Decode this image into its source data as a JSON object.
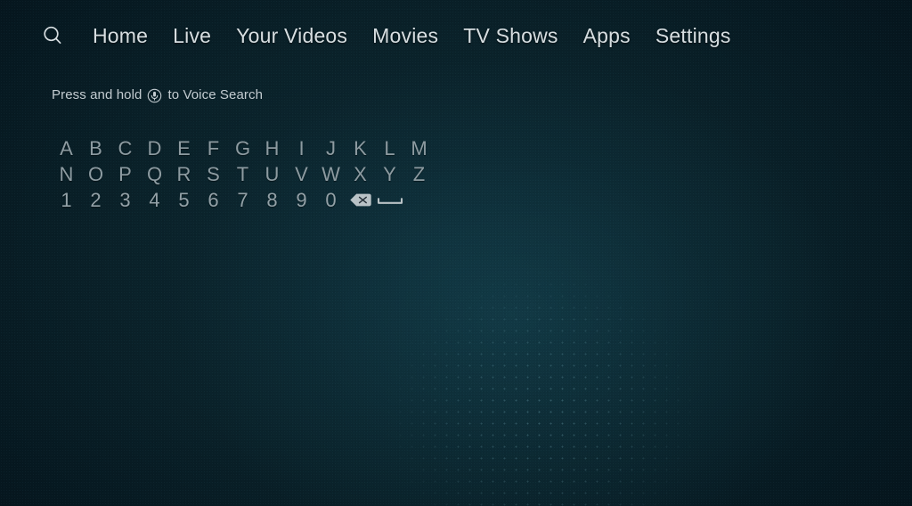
{
  "nav": {
    "search_icon": "search-icon",
    "items": [
      {
        "label": "Home"
      },
      {
        "label": "Live"
      },
      {
        "label": "Your Videos"
      },
      {
        "label": "Movies"
      },
      {
        "label": "TV Shows"
      },
      {
        "label": "Apps"
      },
      {
        "label": "Settings"
      }
    ]
  },
  "voice_hint": {
    "prefix": "Press and hold",
    "icon": "microphone-icon",
    "suffix": "to Voice Search",
    "full_text": "Press and hold   to Voice Search"
  },
  "keyboard": {
    "rows": [
      {
        "keys": [
          "A",
          "B",
          "C",
          "D",
          "E",
          "F",
          "G",
          "H",
          "I",
          "J",
          "K",
          "L",
          "M"
        ]
      },
      {
        "keys": [
          "N",
          "O",
          "P",
          "Q",
          "R",
          "S",
          "T",
          "U",
          "V",
          "W",
          "X",
          "Y",
          "Z"
        ]
      },
      {
        "keys": [
          "1",
          "2",
          "3",
          "4",
          "5",
          "6",
          "7",
          "8",
          "9",
          "0"
        ]
      }
    ],
    "backspace_label": "backspace-icon",
    "space_label": "space-icon"
  },
  "colors": {
    "background_center": "#0d2730",
    "background_edge": "#04121a",
    "nav_text": "#d7dee1",
    "hint_text": "#c2cbd0",
    "key_text": "#8d9ba1",
    "key_fill": "#b9c2c6"
  }
}
